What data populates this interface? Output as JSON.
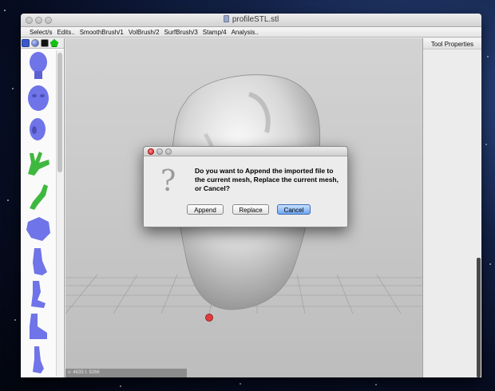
{
  "window": {
    "title": "profileSTL.stl"
  },
  "menu": [
    "Select/s",
    "Edits..",
    "SmoothBrush/1",
    "VolBrush/2",
    "SurfBrush/3",
    "Stamp/4",
    "Analysis.."
  ],
  "left_panel": {
    "tool_icons": [
      "sculpt-tool-icon",
      "sphere-icon",
      "cube-icon",
      "pentagon-icon"
    ],
    "thumbnails": [
      "head-front",
      "face-mask",
      "head-side",
      "hand-green",
      "arm-green",
      "torso",
      "leg-1",
      "leg-2",
      "foot",
      "leg-3",
      "leg-4"
    ]
  },
  "viewport": {
    "status_text": "v: 4635 t: 9266"
  },
  "right_panel": {
    "header": "Tool Properties"
  },
  "dialog": {
    "message": "Do you want to Append the imported file to the current mesh, Replace the current mesh, or Cancel?",
    "buttons": {
      "append": "Append",
      "replace": "Replace",
      "cancel": "Cancel"
    }
  },
  "colors": {
    "mesh_thumb_blue": "#6f74e8",
    "mesh_thumb_green": "#3fb83f",
    "viewport_bg": "#c9c9c9",
    "default_button": "#6ea6ef"
  }
}
